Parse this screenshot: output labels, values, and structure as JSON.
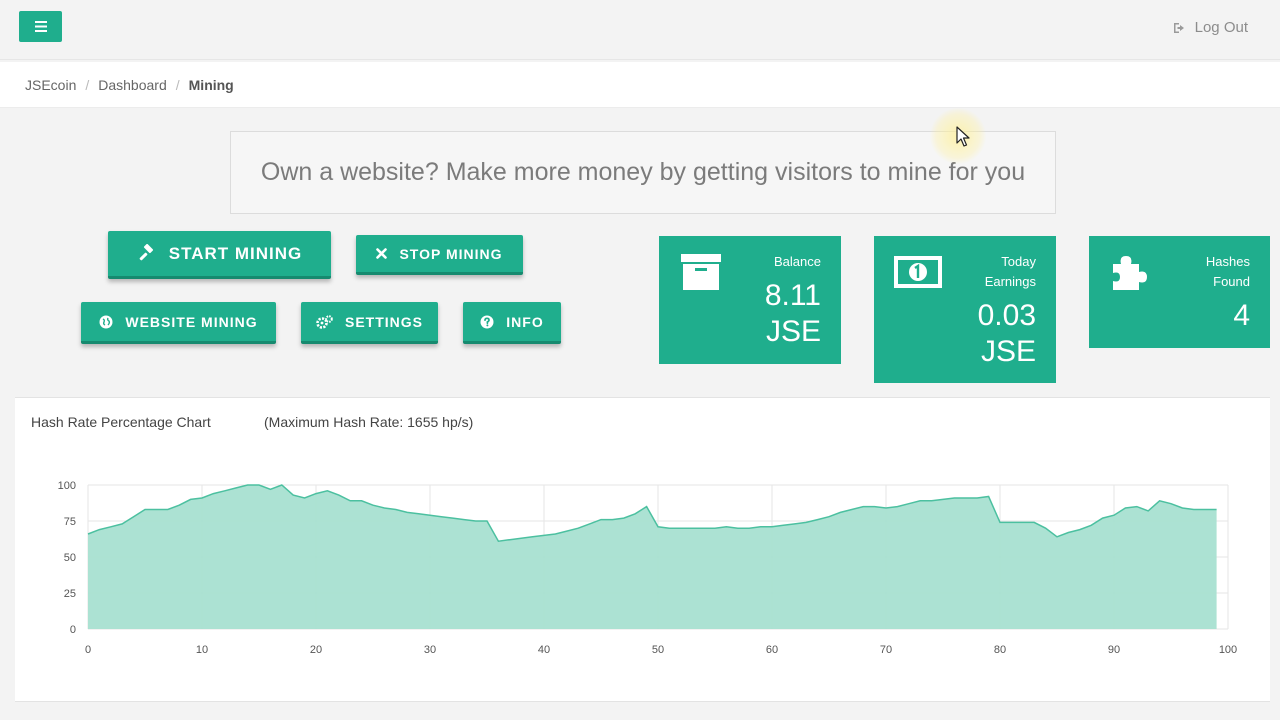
{
  "header": {
    "menu_icon": "hamburger-icon",
    "logout_label": "Log Out",
    "logout_icon": "sign-out-icon"
  },
  "breadcrumb": [
    "JSEcoin",
    "Dashboard",
    "Mining"
  ],
  "banner": {
    "text": "Own a website? Make more money by getting visitors to mine for you"
  },
  "buttons": {
    "start_mining": "START MINING",
    "stop_mining": "STOP MINING",
    "website_mining": "WEBSITE MINING",
    "settings": "SETTINGS",
    "info": "INFO"
  },
  "stats": {
    "balance": {
      "label": "Balance",
      "value_line1": "8.11",
      "value_line2": "JSE",
      "icon": "archive-icon"
    },
    "today": {
      "label_line1": "Today",
      "label_line2": "Earnings",
      "value_line1": "0.03",
      "value_line2": "JSE",
      "icon": "money-bill-icon"
    },
    "hashes": {
      "label_line1": "Hashes",
      "label_line2": "Found",
      "value": "4",
      "icon": "puzzle-icon"
    }
  },
  "chart_panel": {
    "title": "Hash Rate Percentage Chart",
    "subtitle": "(Maximum Hash Rate: 1655 hp/s)"
  },
  "colors": {
    "accent": "#1fae8d",
    "area_fill": "#a8e0d1",
    "area_line": "#4cc0a0"
  },
  "chart_data": {
    "type": "area",
    "xlim": [
      0,
      100
    ],
    "ylim": [
      0,
      100
    ],
    "xticks": [
      0,
      10,
      20,
      30,
      40,
      50,
      60,
      70,
      80,
      90,
      100
    ],
    "yticks": [
      0,
      25,
      50,
      75,
      100
    ],
    "grid": true,
    "x": [
      0,
      1,
      2,
      3,
      4,
      5,
      6,
      7,
      8,
      9,
      10,
      11,
      12,
      13,
      14,
      15,
      16,
      17,
      18,
      19,
      20,
      21,
      22,
      23,
      24,
      25,
      26,
      27,
      28,
      29,
      30,
      31,
      32,
      33,
      34,
      35,
      36,
      37,
      38,
      39,
      40,
      41,
      42,
      43,
      44,
      45,
      46,
      47,
      48,
      49,
      50,
      51,
      52,
      53,
      54,
      55,
      56,
      57,
      58,
      59,
      60,
      61,
      62,
      63,
      64,
      65,
      66,
      67,
      68,
      69,
      70,
      71,
      72,
      73,
      74,
      75,
      76,
      77,
      78,
      79,
      80,
      81,
      82,
      83,
      84,
      85,
      86,
      87,
      88,
      89,
      90,
      91,
      92,
      93,
      94,
      95,
      96,
      97,
      98,
      99
    ],
    "values": [
      66,
      69,
      71,
      73,
      78,
      83,
      83,
      83,
      86,
      90,
      91,
      94,
      96,
      98,
      100,
      100,
      97,
      100,
      93,
      91,
      94,
      96,
      93,
      89,
      89,
      86,
      84,
      83,
      81,
      80,
      79,
      78,
      77,
      76,
      75,
      75,
      61,
      62,
      63,
      64,
      65,
      66,
      68,
      70,
      73,
      76,
      76,
      77,
      80,
      85,
      71,
      70,
      70,
      70,
      70,
      70,
      71,
      70,
      70,
      71,
      71,
      72,
      73,
      74,
      76,
      78,
      81,
      83,
      85,
      85,
      84,
      85,
      87,
      89,
      89,
      90,
      91,
      91,
      91,
      92,
      74,
      74,
      74,
      74,
      70,
      64,
      67,
      69,
      72,
      77,
      79,
      84,
      85,
      82,
      89,
      87,
      84,
      83,
      83,
      83
    ]
  }
}
